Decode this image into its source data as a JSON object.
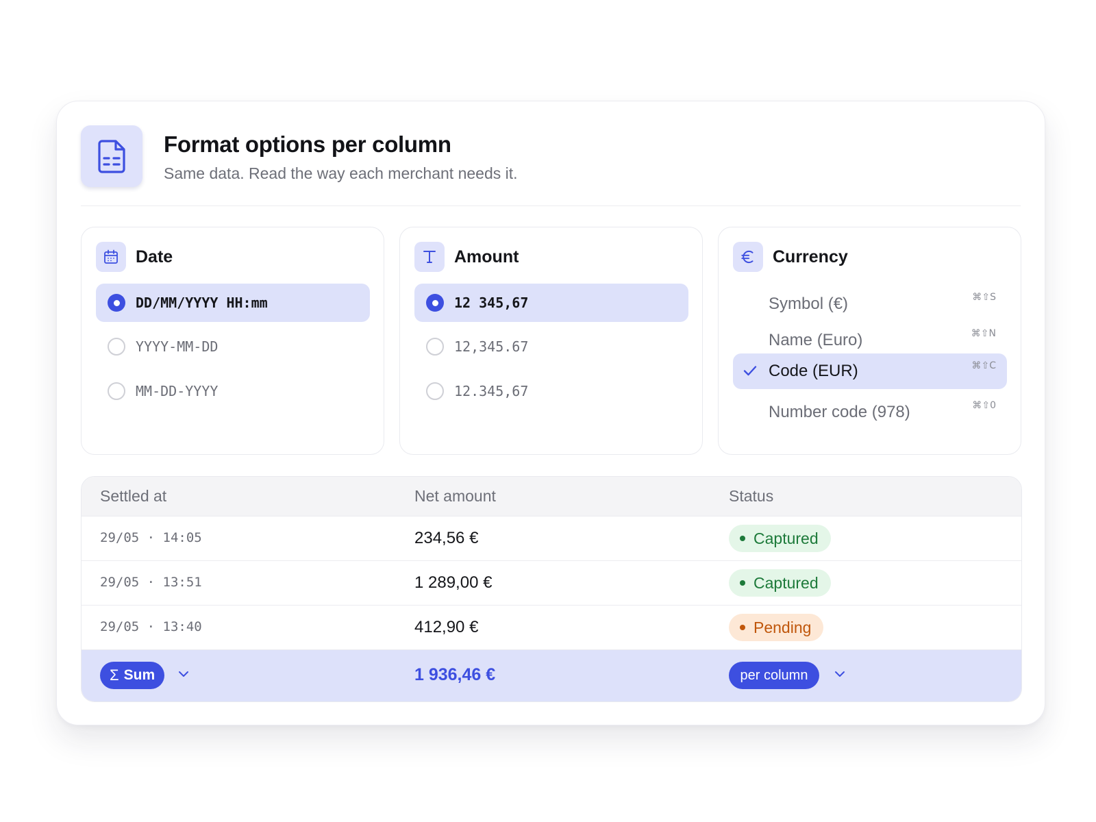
{
  "header": {
    "title": "Format options per column",
    "subtitle": "Same data. Read the way each merchant needs it."
  },
  "panels": {
    "date": {
      "title": "Date",
      "options": [
        {
          "label": "DD/MM/YYYY HH:mm",
          "selected": true
        },
        {
          "label": "YYYY-MM-DD",
          "selected": false
        },
        {
          "label": "MM-DD-YYYY",
          "selected": false
        }
      ]
    },
    "amount": {
      "title": "Amount",
      "options": [
        {
          "label": "12 345,67",
          "selected": true
        },
        {
          "label": "12,345.67",
          "selected": false
        },
        {
          "label": "12.345,67",
          "selected": false
        }
      ]
    },
    "currency": {
      "title": "Currency",
      "options": [
        {
          "label": "Symbol (€)",
          "shortcut": "⌘⇧S",
          "selected": false
        },
        {
          "label": "Name (Euro)",
          "shortcut": "⌘⇧N",
          "selected": false
        },
        {
          "label": "Code (EUR)",
          "shortcut": "⌘⇧C",
          "selected": true
        },
        {
          "label": "Number code (978)",
          "shortcut": "⌘⇧0",
          "selected": false
        }
      ]
    }
  },
  "table": {
    "columns": [
      "Settled at",
      "Net amount",
      "Status"
    ],
    "rows": [
      {
        "settled_at": "29/05 · 14:05",
        "net_amount": "234,56 €",
        "status": "Captured"
      },
      {
        "settled_at": "29/05 · 13:51",
        "net_amount": "1 289,00 €",
        "status": "Captured"
      },
      {
        "settled_at": "29/05 · 13:40",
        "net_amount": "412,90 €",
        "status": "Pending"
      }
    ],
    "footer": {
      "sum_symbol": "Σ",
      "sum_label": "Sum",
      "total": "1 936,46 €",
      "per_column_label": "per column"
    }
  },
  "colors": {
    "accent": "#3d4fe0",
    "selected_bg": "#dde1fa",
    "icon_bg": "#dfe2fb",
    "captured_bg": "#e4f6e8",
    "captured_fg": "#1d7a3a",
    "pending_bg": "#fde8d6",
    "pending_fg": "#c0570c"
  },
  "icons": {
    "header": "document-table-icon",
    "date": "calendar-icon",
    "amount": "text-type-icon",
    "currency": "euro-icon",
    "check": "checkmark-icon",
    "dropdown": "chevron-down-icon"
  }
}
